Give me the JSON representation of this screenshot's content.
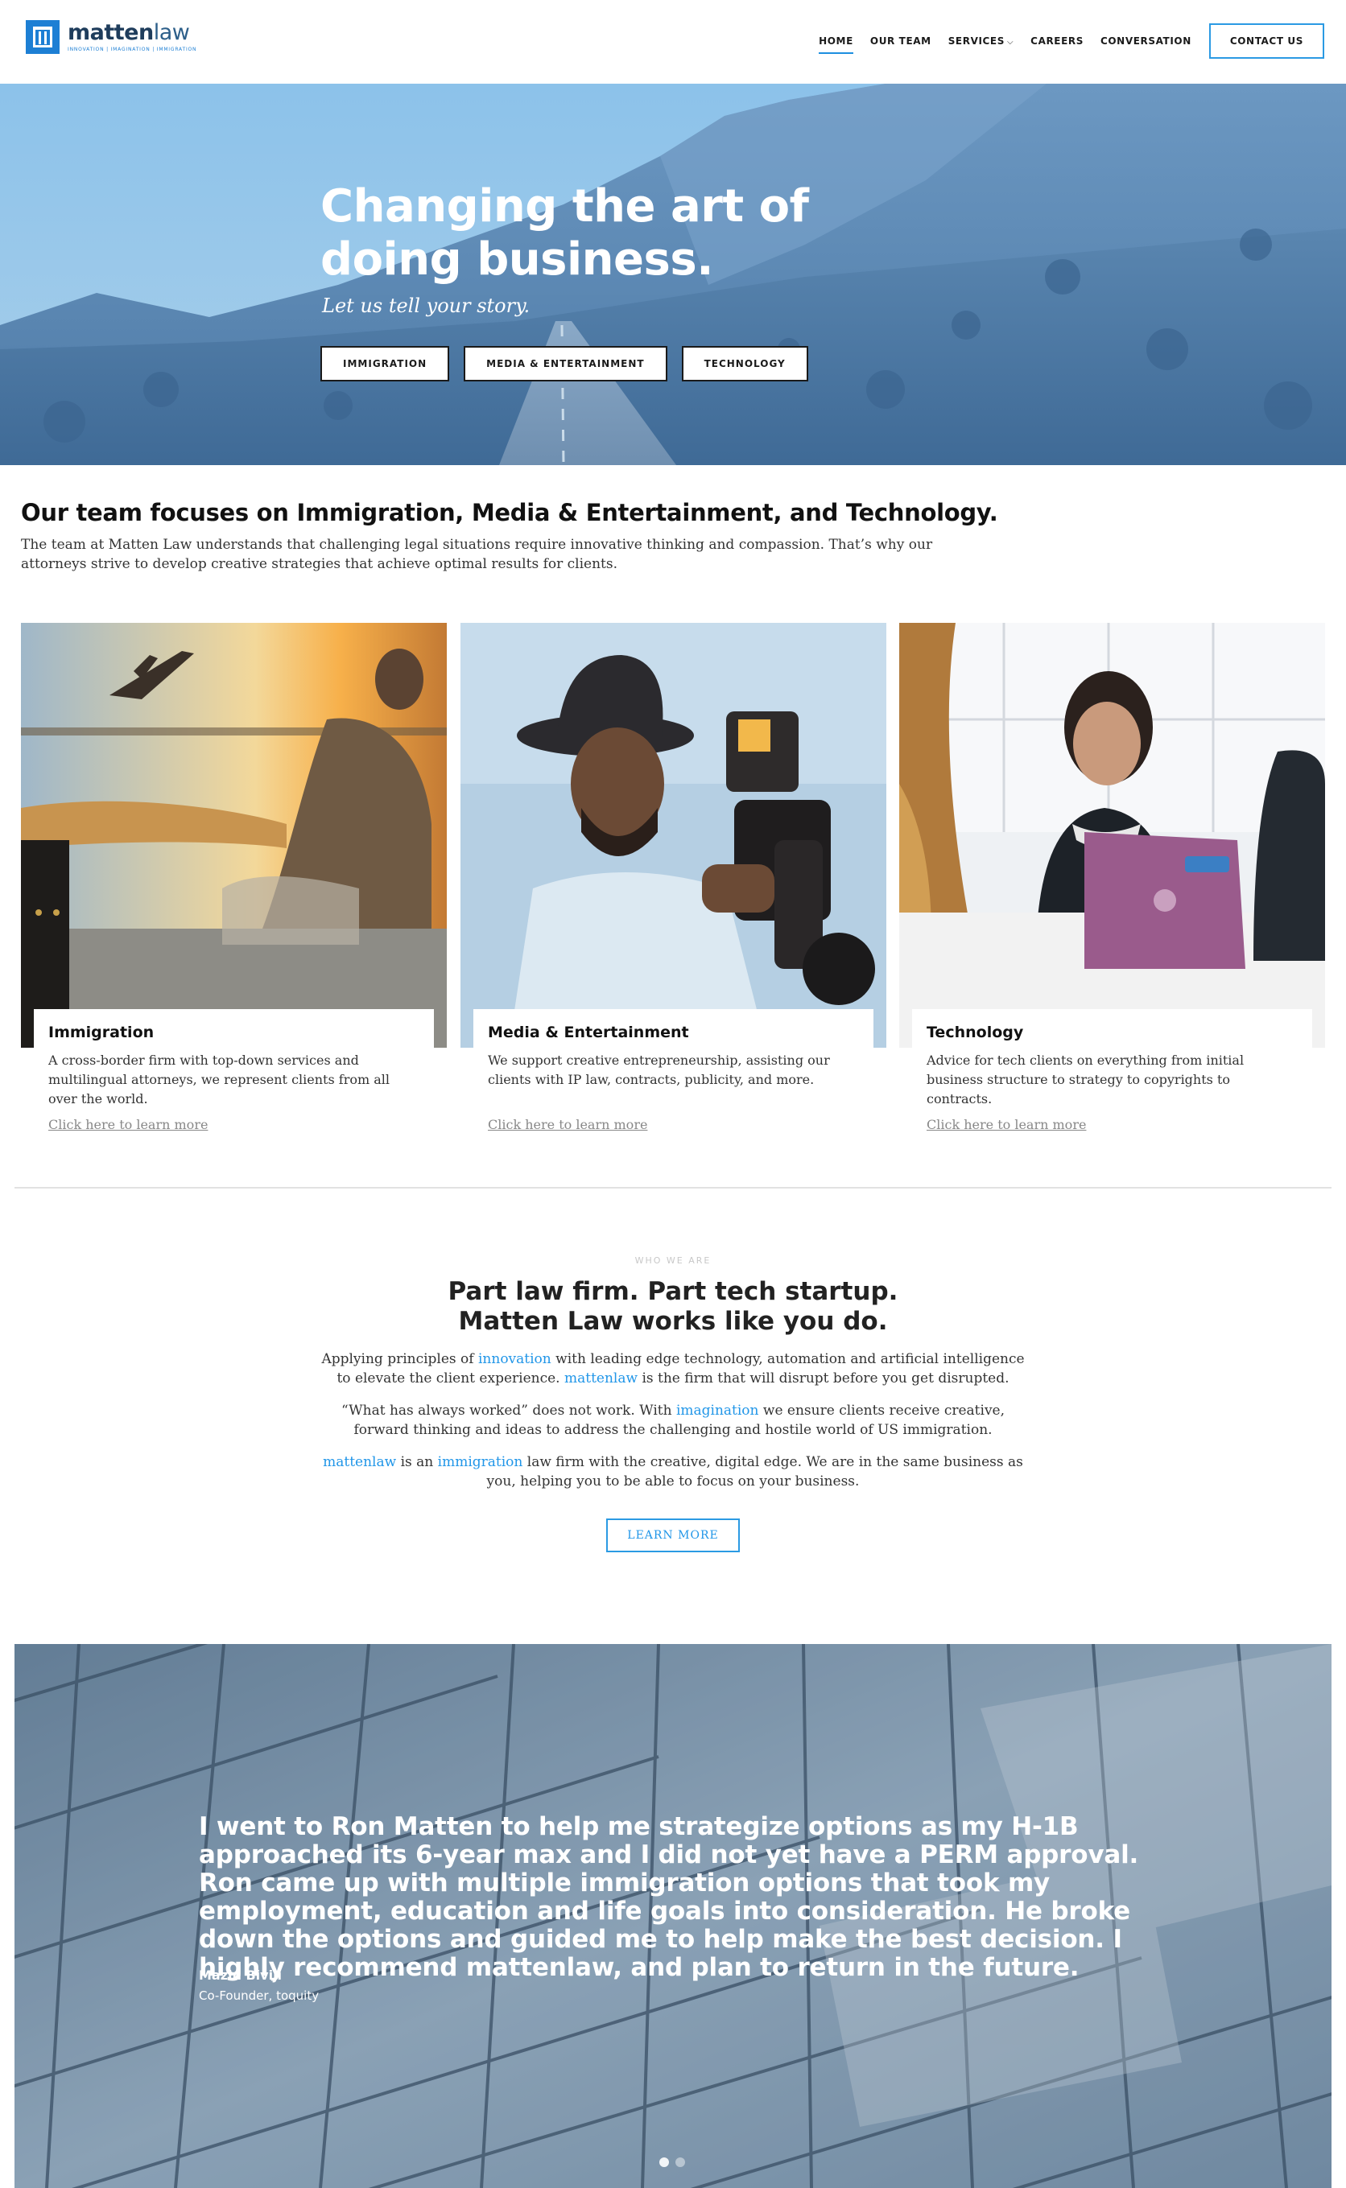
{
  "brand": {
    "name_bold": "matten",
    "name_light": "law",
    "tagline": "INNOVATION | IMAGINATION | IMMIGRATION",
    "accent_color": "#1d7fd4"
  },
  "nav": {
    "items": [
      {
        "label": "HOME",
        "active": true
      },
      {
        "label": "OUR TEAM"
      },
      {
        "label": "SERVICES",
        "has_dropdown": true
      },
      {
        "label": "CAREERS"
      },
      {
        "label": "CONVERSATION"
      }
    ],
    "contact_label": "CONTACT US"
  },
  "hero": {
    "title_line1": "Changing the art of",
    "title_line2": "doing business.",
    "subtitle": "Let us tell your story.",
    "buttons": [
      "IMMIGRATION",
      "MEDIA & ENTERTAINMENT",
      "TECHNOLOGY"
    ]
  },
  "focus": {
    "title": "Our team focuses on Immigration, Media & Entertainment, and Technology.",
    "text": "The team at Matten Law understands that challenging legal situations require innovative thinking and compassion. That’s why our attorneys strive to develop creative strategies that achieve optimal results for clients."
  },
  "cards": [
    {
      "title": "Immigration",
      "desc": "A cross-border firm with top-down services and multilingual attorneys, we represent clients from all over the world.",
      "link": "Click here to learn more"
    },
    {
      "title": "Media & Entertainment",
      "desc": "We support creative entrepreneurship, assisting our clients with IP law, contracts, publicity, and more.",
      "link": "Click here to learn more"
    },
    {
      "title": "Technology",
      "desc": "Advice for tech clients on everything from initial business structure to strategy to copyrights to contracts.",
      "link": "Click here to learn more"
    }
  ],
  "who": {
    "eyebrow": "WHO WE ARE",
    "heading_line1": "Part law firm. Part tech startup.",
    "heading_line2": "Matten Law works like you do.",
    "p1": {
      "a": "Applying principles of ",
      "hl": "innovation",
      "b": " with leading edge technology, automation and artificial intelligence to elevate the client experience. ",
      "hl2": "mattenlaw",
      "c": " is the firm that will disrupt before you get disrupted."
    },
    "p2": {
      "a": "“What has always worked” does not work. With ",
      "hl": "imagination",
      "b": " we ensure clients receive creative, forward thinking and ideas to address the challenging and hostile world of US immigration."
    },
    "p3": {
      "hl": "mattenlaw",
      "a": " is an ",
      "hl2": "immigration",
      "b": " law firm with the creative, digital edge. We are in the same business as you, helping you to be able to focus on your business."
    },
    "button": "LEARN MORE",
    "highlight_color": "#2196e8"
  },
  "testimonial": {
    "quote": "I went to Ron Matten to help me strategize options as my H-1B approached its 6-year max and I did not yet have a PERM approval. Ron came up with multiple immigration options that took my employment, education and life goals into consideration. He broke down the options and guided me to help make the best decision. I highly recommend mattenlaw, and plan to return in the future.",
    "name": "Mazin Biviji",
    "role": "Co-Founder, toquity",
    "slides": 2,
    "active_slide": 1
  }
}
